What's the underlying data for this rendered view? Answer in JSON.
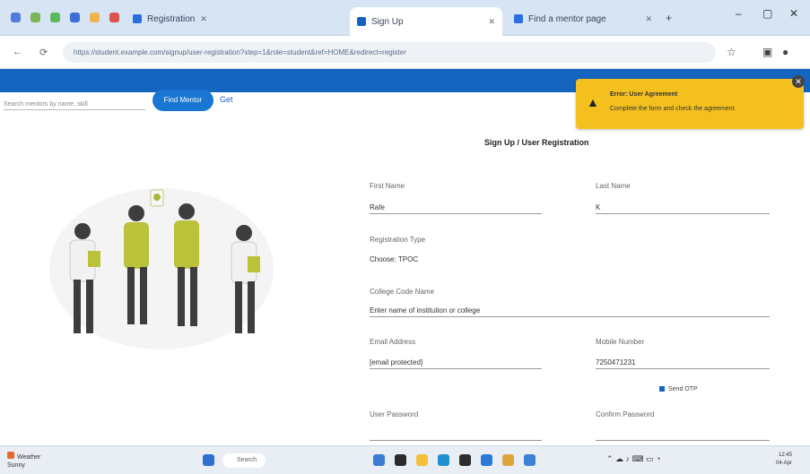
{
  "browser": {
    "tabs": [
      {
        "label": "Registration"
      },
      {
        "label": "Sign Up"
      },
      {
        "label": "Find a mentor page"
      }
    ],
    "new_tab": "+",
    "url": "https://student.example.com/signup/user-registration?step=1&role=student&ref=HOME&redirect=register",
    "window_controls": [
      "–",
      "▢",
      "✕"
    ]
  },
  "header": {
    "search_placeholder": "Search mentors by name, skill",
    "find_button": "Find Mentor",
    "get_link": "Get"
  },
  "toast": {
    "title": "Error: User Agreement",
    "message": "Complete the form and check the agreement."
  },
  "form": {
    "title": "Sign Up / User Registration",
    "first_name_label": "First Name",
    "first_name_value": "Rafe",
    "last_name_label": "Last Name",
    "last_name_value": "K",
    "registration_type_label": "Registration Type",
    "registration_type_value": "Choose: TPOC",
    "college_label": "College Code Name",
    "college_value": "Enter name of institution or college",
    "email_label": "Email Address",
    "email_value": "[email protected]",
    "mobile_label": "Mobile Number",
    "mobile_value": "7250471231",
    "sms_checkbox": "Send OTP",
    "password_label": "User Password",
    "confirm_label": "Confirm Password"
  },
  "taskbar": {
    "weather_line1": "Weather",
    "weather_line2": "Sunny",
    "search_label": "Search",
    "clock_time": "12:45",
    "clock_date": "04-Apr"
  }
}
